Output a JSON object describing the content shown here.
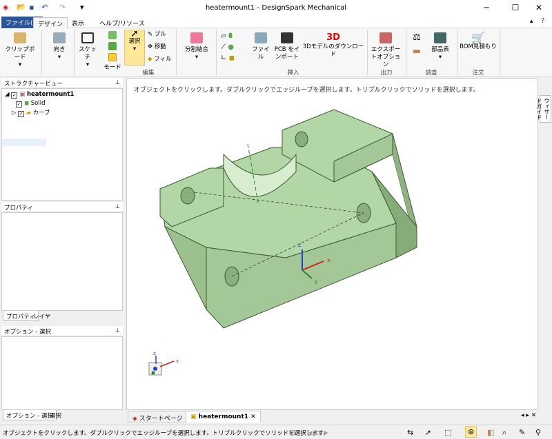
{
  "window": {
    "title": "heatermount1 - DesignSpark Mechanical",
    "minimize": "─",
    "maximize": "☐",
    "close": "✕"
  },
  "quick_access": {
    "undo": "↶",
    "redo": "↷",
    "more": "▾"
  },
  "tabs": {
    "file": "ファイル(F)",
    "design": "デザイン",
    "view": "表示",
    "help": "ヘルプ/リソース"
  },
  "ribbon": {
    "clipboard": "クリップボード",
    "orient": "向き",
    "sketch": "スケッチ",
    "mode": "モード",
    "select": "選択",
    "pull": "プル",
    "move": "移動",
    "fill": "フィル",
    "edit_group": "編集",
    "combine": "分割結合",
    "file": "ファイル",
    "pcb": "PCB をインポート",
    "model3d": "3Dモデルのダウンロード",
    "insert_group": "挿入",
    "export": "エクスポートオプション",
    "output_group": "出力",
    "parts": "部品表",
    "inspect_group": "調査",
    "bom": "BOM見積もり",
    "order_group": "注文",
    "logo3d": "3D"
  },
  "structure": {
    "title": "ストラクチャービュー",
    "root": "heatermount1",
    "solid": "Solid",
    "curves": "カーブ"
  },
  "properties": {
    "title": "プロパティ",
    "tab_props": "プロパティ",
    "tab_layers": "レイヤ"
  },
  "options": {
    "title": "オプション - 選択",
    "tab_options": "オプション - 選択",
    "tab_select": "選択"
  },
  "viewport": {
    "hint": "オブジェクトをクリックします。ダブルクリックでエッジループを選択します。トリプルクリックでソリッドを選択します。"
  },
  "side_tab": "ウィザードガイド",
  "doc_tabs": {
    "start": "スタートページ",
    "model": "heatermount1"
  },
  "status": {
    "message": "オブジェクトをクリックします。ダブルクリックでエッジループを選択します。トリプルクリックでソリッドを選択します。"
  },
  "axes": {
    "x": "x",
    "y": "y",
    "z": "z"
  }
}
